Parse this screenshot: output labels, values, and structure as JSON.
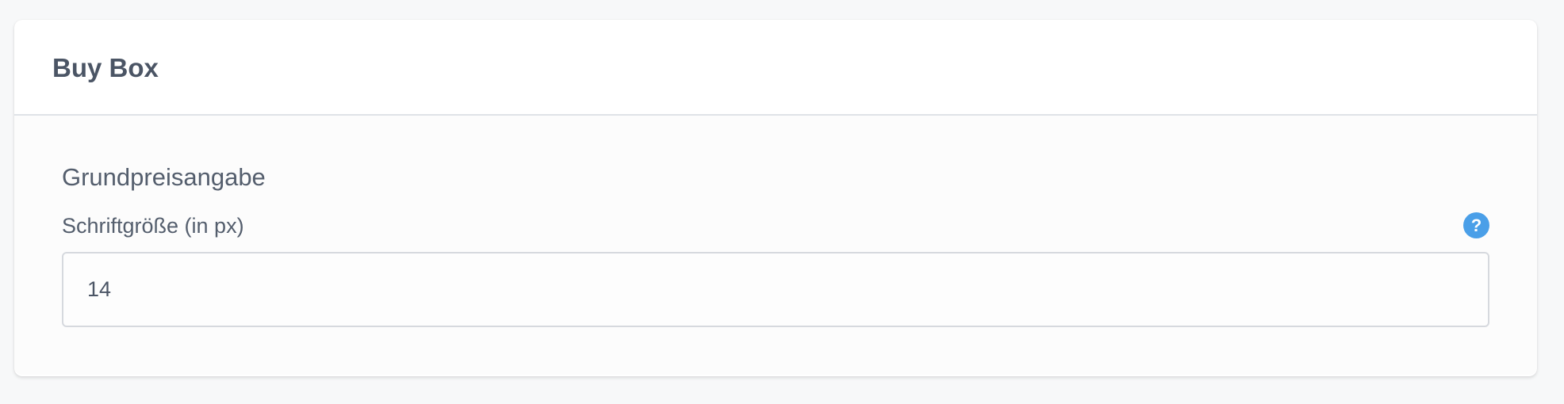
{
  "card": {
    "title": "Buy Box"
  },
  "section": {
    "title": "Grundpreisangabe"
  },
  "font_size_field": {
    "label": "Schriftgröße (in px)",
    "value": "14",
    "help_icon_glyph": "?"
  },
  "colors": {
    "accent": "#4a9fe8",
    "text": "#4b5565",
    "border": "#d6d9de"
  }
}
